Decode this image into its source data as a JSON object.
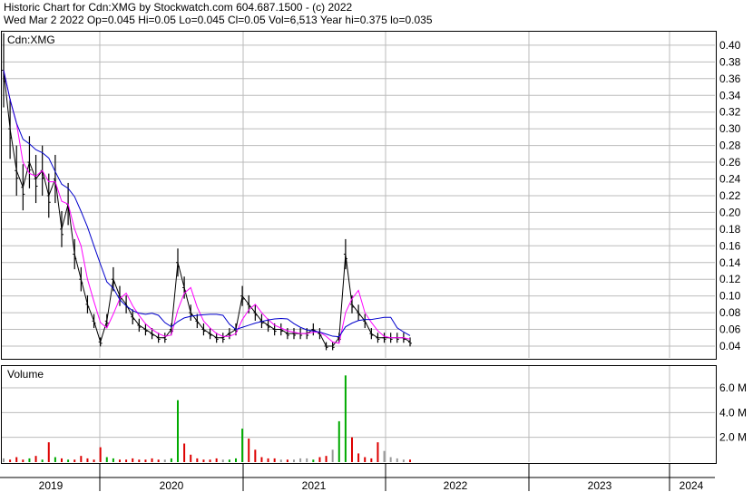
{
  "header": {
    "line1": "Historic Chart for Cdn:XMG by Stockwatch.com 604.687.1500 - (c) 2022",
    "line2": "Wed Mar  2 2022   Op=0.045   Hi=0.05   Lo=0.045   Cl=0.05   Vol=6,513   Year hi=0.375   lo=0.035"
  },
  "panels": {
    "price_title": "Cdn:XMG",
    "volume_title": "Volume"
  },
  "colors": {
    "price_bars": "#000000",
    "ma_short": "#ff00ff",
    "ma_long": "#0000cc",
    "volume_up": "#00aa00",
    "volume_down": "#dd0000",
    "volume_flat": "#999999",
    "grid": "#bbbbbb"
  },
  "chart_data": [
    {
      "type": "line",
      "title": "Cdn:XMG",
      "series": [
        {
          "values": [
            0.37,
            0.3,
            0.25,
            0.23,
            0.26,
            0.24,
            0.25,
            0.22,
            0.24,
            0.18,
            0.21,
            0.15,
            0.12,
            0.09,
            0.07,
            0.045,
            0.07,
            0.12,
            0.1,
            0.09,
            0.075,
            0.065,
            0.06,
            0.055,
            0.05,
            0.05,
            0.06,
            0.14,
            0.11,
            0.08,
            0.07,
            0.06,
            0.055,
            0.05,
            0.05,
            0.055,
            0.06,
            0.1,
            0.09,
            0.08,
            0.07,
            0.065,
            0.06,
            0.06,
            0.055,
            0.055,
            0.055,
            0.055,
            0.06,
            0.055,
            0.04,
            0.04,
            0.05,
            0.15,
            0.09,
            0.08,
            0.07,
            0.055,
            0.05,
            0.05,
            0.05,
            0.05,
            0.05,
            0.045
          ]
        }
      ],
      "x": [
        "2019",
        "2020",
        "2021",
        "2022",
        "2023",
        "2024"
      ],
      "ylim": [
        0.02,
        0.41
      ],
      "yticks": [
        "0.04",
        "0.06",
        "0.08",
        "0.10",
        "0.12",
        "0.14",
        "0.16",
        "0.18",
        "0.20",
        "0.22",
        "0.24",
        "0.26",
        "0.28",
        "0.30",
        "0.32",
        "0.34",
        "0.36",
        "0.38",
        "0.40"
      ],
      "grid": true
    },
    {
      "type": "bar",
      "title": "Volume",
      "values": [
        0.3,
        0.2,
        0.4,
        0.2,
        0.3,
        0.5,
        0.2,
        1.6,
        0.4,
        0.3,
        0.2,
        0.2,
        0.5,
        0.3,
        0.2,
        1.2,
        0.4,
        0.3,
        0.2,
        0.2,
        0.3,
        0.2,
        0.2,
        0.3,
        0.2,
        0.2,
        0.3,
        5.0,
        1.5,
        0.6,
        0.3,
        0.2,
        0.2,
        0.3,
        0.2,
        0.2,
        0.3,
        2.7,
        1.9,
        1.0,
        0.4,
        0.3,
        0.3,
        0.2,
        0.2,
        0.2,
        0.3,
        0.3,
        0.2,
        0.4,
        0.5,
        1.0,
        3.3,
        7.0,
        2.0,
        0.7,
        0.4,
        0.3,
        1.6,
        0.9,
        0.4,
        0.3,
        0.2,
        0.2
      ],
      "ylim": [
        0,
        7.5
      ],
      "yticks": [
        "2.0 M",
        "4.0 M",
        "6.0 M"
      ],
      "ylabel": "Volume"
    }
  ]
}
